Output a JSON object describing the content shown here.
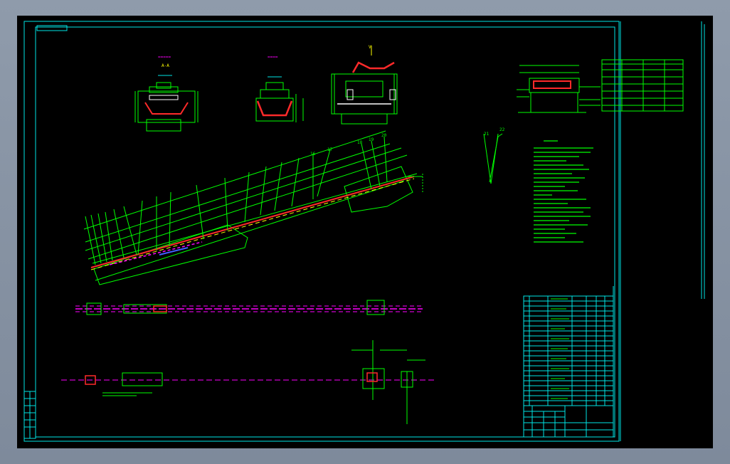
{
  "drawing": {
    "colors": {
      "background": "#000000",
      "frame": "#00e5e5",
      "structure": "#00ff00",
      "belt": "#ff2a2a",
      "centerline": "#ff00ff",
      "accent": "#ffff00",
      "white": "#ffffff",
      "blue": "#4060ff"
    },
    "balloon_numbers": [
      "10",
      "11",
      "12",
      "13",
      "14",
      "15",
      "16",
      "17",
      "18",
      "19",
      "20",
      "21",
      "22"
    ],
    "section_label": "A-A",
    "tables": {
      "parts_list_rows": 22,
      "top_table_rows": 6
    }
  }
}
